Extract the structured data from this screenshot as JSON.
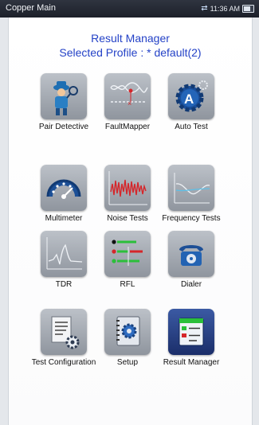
{
  "titlebar": {
    "app_name": "Copper Main",
    "time": "11:36 AM"
  },
  "heading": {
    "title": "Result Manager",
    "profile": "Selected Profile : * default(2)"
  },
  "tiles": [
    {
      "label": "Pair Detective",
      "icon": "pair-detective-icon"
    },
    {
      "label": "FaultMapper",
      "icon": "faultmapper-icon"
    },
    {
      "label": "Auto Test",
      "icon": "auto-test-icon"
    },
    {
      "label": "Multimeter",
      "icon": "multimeter-icon"
    },
    {
      "label": "Noise Tests",
      "icon": "noise-tests-icon"
    },
    {
      "label": "Frequency Tests",
      "icon": "frequency-tests-icon"
    },
    {
      "label": "TDR",
      "icon": "tdr-icon"
    },
    {
      "label": "RFL",
      "icon": "rfl-icon"
    },
    {
      "label": "Dialer",
      "icon": "dialer-icon"
    },
    {
      "label": "Test Configuration",
      "icon": "test-configuration-icon"
    },
    {
      "label": "Setup",
      "icon": "setup-icon"
    },
    {
      "label": "Result Manager",
      "icon": "result-manager-icon",
      "selected": true
    }
  ],
  "colors": {
    "heading": "#2442c7",
    "selected_tile": "#1b2e6a",
    "titlebar": "#1c2029"
  }
}
